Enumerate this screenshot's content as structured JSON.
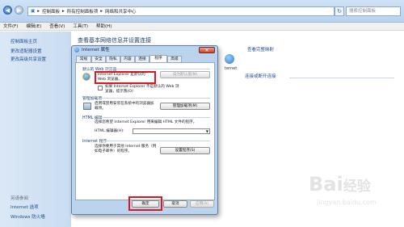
{
  "window": {
    "breadcrumb": [
      "控制面板",
      "所有控制面板项",
      "网络和共享中心"
    ],
    "search_placeholder": "搜索控制面板",
    "menu": [
      "文件(F)",
      "编辑(E)",
      "查看(V)",
      "工具(T)",
      "帮助(H)"
    ]
  },
  "left_pane": {
    "links": [
      "控制面板主页",
      "更改适配器设置",
      "更改高级共享设置"
    ],
    "see_also_title": "另请参阅",
    "see_also": [
      "Internet 选项",
      "Windows 防火墙"
    ]
  },
  "content": {
    "heading": "查看基本网络信息并设置连接",
    "view_full_map": "查看完整映射",
    "internet_label": "ternet",
    "connect_disconnect": "连接或断开连接"
  },
  "dialog": {
    "title": "Internet 属性",
    "tabs": [
      "常规",
      "安全",
      "隐私",
      "内容",
      "连接",
      "程序",
      "高级"
    ],
    "active_tab_index": 5,
    "default_browser": {
      "heading": "默认的 Web 浏览器",
      "status_text": "Internet Explorer 是默认的 Web 浏览器。",
      "set_default_button": "设为默认值(M)",
      "checkbox_label": "如果 Internet Explorer 不是默认的 Web 浏览器，提示我(O)"
    },
    "addons": {
      "heading": "管理加载项",
      "text": "启用或禁用安装在系统中的浏览器加载项。",
      "button": "管理加载项(M)"
    },
    "html_editing": {
      "heading": "HTML 编辑",
      "text": "选择您希望 Internet Explorer 用来编辑 HTML 文件的程序。",
      "editor_label": "HTML 编辑器(H):",
      "editor_value": ""
    },
    "internet_programs": {
      "heading": "Internet 程序",
      "text": "选择你要用于其他 Internet 服务（例如电子邮件）的程序。",
      "button": "设置程序(S)"
    },
    "buttons": {
      "ok": "确定",
      "cancel": "取消",
      "apply": "应用(A)"
    }
  },
  "watermark": {
    "brand": "Bai",
    "brand_suffix": "经验",
    "url": "jingyan.baidu.com"
  }
}
